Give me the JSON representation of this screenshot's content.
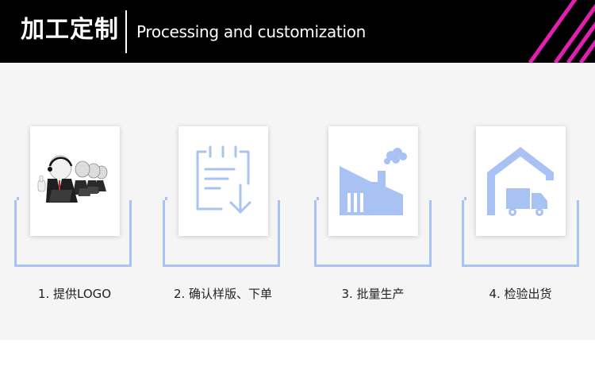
{
  "header": {
    "title_zh": "加工定制",
    "title_en": "Processing and customization",
    "stripe_color": "#e020b0"
  },
  "steps": [
    {
      "label": "1. 提供LOGO",
      "icon": "customer-service-team-icon"
    },
    {
      "label": "2. 确认样版、下单",
      "icon": "clipboard-download-icon"
    },
    {
      "label": "3. 批量生产",
      "icon": "factory-icon"
    },
    {
      "label": "4. 检验出货",
      "icon": "warehouse-truck-icon"
    }
  ],
  "colors": {
    "accent": "#a8c3f3",
    "background": "#f5f5f5"
  }
}
